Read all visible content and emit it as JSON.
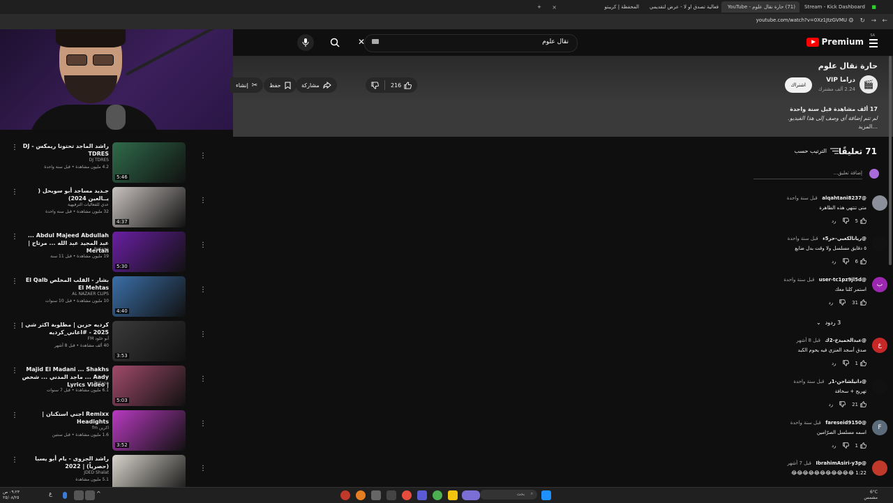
{
  "browser": {
    "tabs": [
      {
        "label": "Stream - Kick Dashboard"
      },
      {
        "label": "(71) حارة نقال علوم - YouTube"
      },
      {
        "label": "فعالية تصدق او لا - عرض لتقديمي"
      },
      {
        "label": "المحفظة | كريبتو"
      }
    ],
    "new_tab": "+",
    "url": "youtube.com/watch?v=0Xz1JtzGVMU"
  },
  "youtube": {
    "logo_text": "Premium",
    "logo_cc": "SA",
    "search_value": "نقال علوم",
    "kbd_icon": "keyboard-icon"
  },
  "video": {
    "title": "حارة نقال علوم",
    "channel_initial": "🎬",
    "channel_name": "دراما VIP",
    "channel_subs": "2.24 ألف مشترك",
    "subscribe": "اشتراك",
    "likes": "216",
    "share": "مشاركة",
    "save": "حفظ",
    "clip": "إنشاء",
    "views": "17 ألف مشاهدة  قبل سنة واحدة",
    "description": "لم تتم إضافة أي وصف إلى هذا الفيديو.",
    "more": "...المزيد"
  },
  "comments": {
    "count": "71 تعليقًا",
    "sort": "الترتيب حسب",
    "add_placeholder": "إضافة تعليق...",
    "reply_label": "رد",
    "items": [
      {
        "author": "@alqahtani8237",
        "time": "قبل سنة واحدة",
        "text": "متى تنتهي هذه الظاهرة",
        "likes": "5",
        "avatar_color": "#8a8f99",
        "initial": ""
      },
      {
        "author": "@ريانالكعبي-حز5ء",
        "time": "قبل سنة واحدة",
        "text": "٥ دقايق مسلسل ولا وقت بدل ضايع",
        "likes": "6",
        "avatar_color": "#111111",
        "initial": ""
      },
      {
        "author": "@user-tc1pz9jl5d",
        "time": "قبل سنة واحدة",
        "text": "استمر كلنا معك",
        "likes": "31",
        "avatar_color": "#9c27b0",
        "initial": "ب"
      },
      {
        "author": "@عبدالحميدخ-2ك",
        "time": "قبل 8 أشهر",
        "text": "صدق أسجد العنزي فيه يحوم الكبد",
        "likes": "1",
        "avatar_color": "#c62828",
        "initial": "ع"
      },
      {
        "author": "@دانيلشاحن-1ر",
        "time": "قبل سنة واحدة",
        "text": "تهريج + سخافة",
        "likes": "21",
        "avatar_color": "#111111",
        "initial": ""
      },
      {
        "author": "@fareseid9150",
        "time": "قبل سنة واحدة",
        "text": "اسمه مسلسل الصرّامين",
        "likes": "1",
        "avatar_color": "#5c6b7a",
        "initial": "F"
      },
      {
        "author": "@IbrahimAsiri-y3p",
        "time": "قبل 7 أشهر",
        "text": "1:22 😂😂😂😂😂😂😂😂😂😂😂",
        "likes": "",
        "avatar_color": "#c0392b",
        "initial": ""
      }
    ],
    "replies_toggle": "3 ردود"
  },
  "recommended": [
    {
      "title": "راشد الماجد تحتونا ريمكس - DJ TDRES",
      "channel": "DJ TDRES",
      "meta": "4.2 مليون مشاهدة • قبل سنة واحدة",
      "duration": "5:46",
      "color": "#2f6b4a"
    },
    {
      "title": "جـديد مساجد أبو سويحل ( يــالعين 2024)",
      "channel": "عدي للفعاليات الترفيهية",
      "meta": "32 مليون مشاهدة • قبل سنة واحدة",
      "duration": "4:37",
      "color": "#c9c3c0"
    },
    {
      "title": "Abdul Majeed Abdullah ... عبد المجيد عبد الله ... مرتاح | Mertah",
      "channel": "Rotana",
      "meta": "19 مليون مشاهدة • قبل 11 سنة",
      "duration": "5:30",
      "color": "#6a1fa3"
    },
    {
      "title": "بشار - القلب المخلص El Qalb El Mehtas",
      "channel": "AL NAZAER CLIPS",
      "meta": "10 مليون مشاهدة • قبل 10 سنوات",
      "duration": "4:40",
      "color": "#3b6fa8"
    },
    {
      "title": "كرديه حزين | مطلوبة اكثر شي | 2025 - #اغاني_كرديه",
      "channel": "أبو خلود FM",
      "meta": "40 ألف مشاهدة • قبل 8 أشهر",
      "duration": "3:53",
      "color": "#3a3a3a"
    },
    {
      "title": "Majid El Madani ... Shakhs Aady ... ماجد المدني ... شخص | Lyrics Video",
      "channel": "Rotana",
      "meta": "6.1 مليون مشاهدة • قبل 7 سنوات",
      "duration": "5:03",
      "color": "#a04a6a"
    },
    {
      "title": "Remixx اجني استكنان | Headights",
      "channel": "اكرين fm",
      "meta": "1.6 مليون مشاهدة • قبل سنتين",
      "duration": "3:52",
      "color": "#b83ac0"
    },
    {
      "title": "راشد الجزوى - يام أبو يسبا (حصرياً) | 2022",
      "channel": "JDED Shalat",
      "meta": "5.1 مليون مشاهدة",
      "duration": "",
      "color": "#d8d4cc"
    }
  ],
  "taskbar": {
    "time": "٠٩:٢٣ ص",
    "date": "٢٥/٠٨/٢٥",
    "weather": "6°C",
    "weather_desc": "مشمس",
    "search": "بحث"
  }
}
